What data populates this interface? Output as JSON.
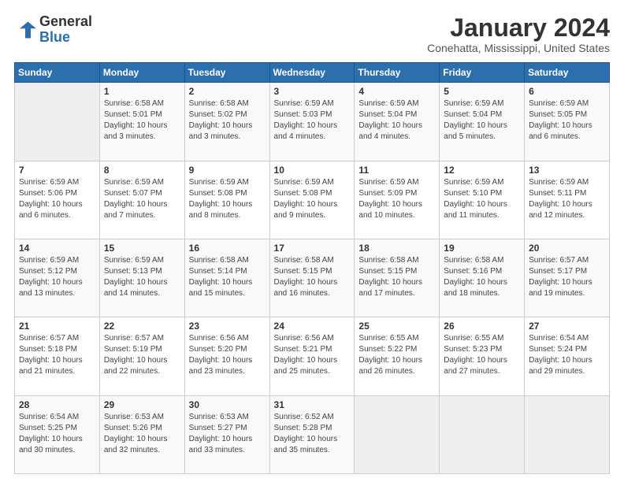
{
  "logo": {
    "general": "General",
    "blue": "Blue"
  },
  "title": "January 2024",
  "subtitle": "Conehatta, Mississippi, United States",
  "days_of_week": [
    "Sunday",
    "Monday",
    "Tuesday",
    "Wednesday",
    "Thursday",
    "Friday",
    "Saturday"
  ],
  "weeks": [
    [
      {
        "day": "",
        "info": ""
      },
      {
        "day": "1",
        "info": "Sunrise: 6:58 AM\nSunset: 5:01 PM\nDaylight: 10 hours\nand 3 minutes."
      },
      {
        "day": "2",
        "info": "Sunrise: 6:58 AM\nSunset: 5:02 PM\nDaylight: 10 hours\nand 3 minutes."
      },
      {
        "day": "3",
        "info": "Sunrise: 6:59 AM\nSunset: 5:03 PM\nDaylight: 10 hours\nand 4 minutes."
      },
      {
        "day": "4",
        "info": "Sunrise: 6:59 AM\nSunset: 5:04 PM\nDaylight: 10 hours\nand 4 minutes."
      },
      {
        "day": "5",
        "info": "Sunrise: 6:59 AM\nSunset: 5:04 PM\nDaylight: 10 hours\nand 5 minutes."
      },
      {
        "day": "6",
        "info": "Sunrise: 6:59 AM\nSunset: 5:05 PM\nDaylight: 10 hours\nand 6 minutes."
      }
    ],
    [
      {
        "day": "7",
        "info": "Sunrise: 6:59 AM\nSunset: 5:06 PM\nDaylight: 10 hours\nand 6 minutes."
      },
      {
        "day": "8",
        "info": "Sunrise: 6:59 AM\nSunset: 5:07 PM\nDaylight: 10 hours\nand 7 minutes."
      },
      {
        "day": "9",
        "info": "Sunrise: 6:59 AM\nSunset: 5:08 PM\nDaylight: 10 hours\nand 8 minutes."
      },
      {
        "day": "10",
        "info": "Sunrise: 6:59 AM\nSunset: 5:08 PM\nDaylight: 10 hours\nand 9 minutes."
      },
      {
        "day": "11",
        "info": "Sunrise: 6:59 AM\nSunset: 5:09 PM\nDaylight: 10 hours\nand 10 minutes."
      },
      {
        "day": "12",
        "info": "Sunrise: 6:59 AM\nSunset: 5:10 PM\nDaylight: 10 hours\nand 11 minutes."
      },
      {
        "day": "13",
        "info": "Sunrise: 6:59 AM\nSunset: 5:11 PM\nDaylight: 10 hours\nand 12 minutes."
      }
    ],
    [
      {
        "day": "14",
        "info": "Sunrise: 6:59 AM\nSunset: 5:12 PM\nDaylight: 10 hours\nand 13 minutes."
      },
      {
        "day": "15",
        "info": "Sunrise: 6:59 AM\nSunset: 5:13 PM\nDaylight: 10 hours\nand 14 minutes."
      },
      {
        "day": "16",
        "info": "Sunrise: 6:58 AM\nSunset: 5:14 PM\nDaylight: 10 hours\nand 15 minutes."
      },
      {
        "day": "17",
        "info": "Sunrise: 6:58 AM\nSunset: 5:15 PM\nDaylight: 10 hours\nand 16 minutes."
      },
      {
        "day": "18",
        "info": "Sunrise: 6:58 AM\nSunset: 5:15 PM\nDaylight: 10 hours\nand 17 minutes."
      },
      {
        "day": "19",
        "info": "Sunrise: 6:58 AM\nSunset: 5:16 PM\nDaylight: 10 hours\nand 18 minutes."
      },
      {
        "day": "20",
        "info": "Sunrise: 6:57 AM\nSunset: 5:17 PM\nDaylight: 10 hours\nand 19 minutes."
      }
    ],
    [
      {
        "day": "21",
        "info": "Sunrise: 6:57 AM\nSunset: 5:18 PM\nDaylight: 10 hours\nand 21 minutes."
      },
      {
        "day": "22",
        "info": "Sunrise: 6:57 AM\nSunset: 5:19 PM\nDaylight: 10 hours\nand 22 minutes."
      },
      {
        "day": "23",
        "info": "Sunrise: 6:56 AM\nSunset: 5:20 PM\nDaylight: 10 hours\nand 23 minutes."
      },
      {
        "day": "24",
        "info": "Sunrise: 6:56 AM\nSunset: 5:21 PM\nDaylight: 10 hours\nand 25 minutes."
      },
      {
        "day": "25",
        "info": "Sunrise: 6:55 AM\nSunset: 5:22 PM\nDaylight: 10 hours\nand 26 minutes."
      },
      {
        "day": "26",
        "info": "Sunrise: 6:55 AM\nSunset: 5:23 PM\nDaylight: 10 hours\nand 27 minutes."
      },
      {
        "day": "27",
        "info": "Sunrise: 6:54 AM\nSunset: 5:24 PM\nDaylight: 10 hours\nand 29 minutes."
      }
    ],
    [
      {
        "day": "28",
        "info": "Sunrise: 6:54 AM\nSunset: 5:25 PM\nDaylight: 10 hours\nand 30 minutes."
      },
      {
        "day": "29",
        "info": "Sunrise: 6:53 AM\nSunset: 5:26 PM\nDaylight: 10 hours\nand 32 minutes."
      },
      {
        "day": "30",
        "info": "Sunrise: 6:53 AM\nSunset: 5:27 PM\nDaylight: 10 hours\nand 33 minutes."
      },
      {
        "day": "31",
        "info": "Sunrise: 6:52 AM\nSunset: 5:28 PM\nDaylight: 10 hours\nand 35 minutes."
      },
      {
        "day": "",
        "info": ""
      },
      {
        "day": "",
        "info": ""
      },
      {
        "day": "",
        "info": ""
      }
    ]
  ]
}
